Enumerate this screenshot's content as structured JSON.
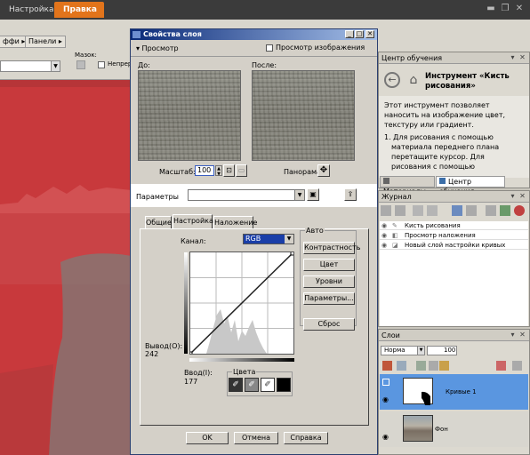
{
  "topbar": {
    "tab_settings": "Настройка",
    "tab_edit": "Правка",
    "win_minimize": "▬",
    "win_restore": "❐",
    "win_close": "✕"
  },
  "toolbar": {
    "effects_btn": "ффи ▸",
    "panels_btn": "Панели ▸",
    "mask_label": "Мазок:",
    "continuous_label": "Непреры"
  },
  "dialog": {
    "title": "Свойства слоя",
    "preview_button": "▾ Просмотр",
    "preview_image_label": "Просмотр изображения",
    "before_label": "До:",
    "after_label": "После:",
    "scale_label": "Масштаб:",
    "scale_value": "100",
    "pan_label": "Панорама:",
    "params_label": "Параметры",
    "tabs": [
      "Общие",
      "Настройка",
      "Наложение"
    ],
    "auto_label": "Авто",
    "channel_label": "Канал:",
    "channel_value": "RGB",
    "auto_buttons": [
      "Контрастность",
      "Цвет",
      "Уровни",
      "Параметры..."
    ],
    "reset_button": "Сброс",
    "output_label": "Вывод(О):",
    "output_value": "242",
    "input_label": "Ввод(I):",
    "input_value": "177",
    "colors_label": "Цвета",
    "ok_button": "OK",
    "cancel_button": "Отмена",
    "help_button": "Справка"
  },
  "learning_center": {
    "title": "Центр обучения",
    "tool_title": "Инструмент «Кисть рисования»",
    "description": "Этот инструмент позволяет наносить на изображение цвет, текстуру или градиент.",
    "step": "1. Для рисования с помощью материала переднего плана перетащите курсор. Для рисования с помощью",
    "tab_materials": "Материалы",
    "tab_learning": "Центр обучения"
  },
  "journal": {
    "title": "Журнал",
    "items": [
      "Кисть рисования",
      "Просмотр наложения",
      "Новый слой настройки кривых"
    ]
  },
  "layers": {
    "title": "Слои",
    "blend_mode": "Норма",
    "opacity": "100",
    "items": [
      {
        "name": "Кривые 1"
      },
      {
        "name": "Фон"
      }
    ]
  }
}
